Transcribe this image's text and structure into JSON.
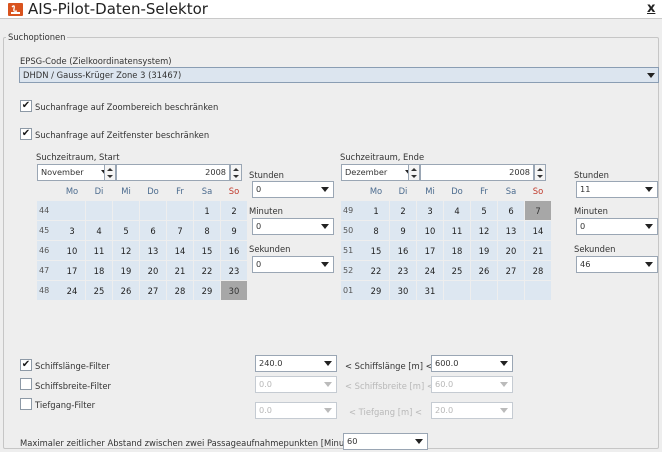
{
  "window": {
    "title": "AIS-Pilot-Daten-Selektor",
    "close_label": "x"
  },
  "options_group": {
    "label": "Suchoptionen"
  },
  "epsg": {
    "label": "EPSG-Code (Zielkoordinatensystem)",
    "value": "DHDN / Gauss-Krüger Zone 3 (31467)"
  },
  "zoom_filter": {
    "label": "Suchanfrage auf Zoombereich beschränken",
    "checked": true
  },
  "time_filter": {
    "label": "Suchanfrage auf Zeitfenster beschränken",
    "checked": true
  },
  "weekday_headers": [
    "Mo",
    "Di",
    "Mi",
    "Do",
    "Fr",
    "Sa",
    "So"
  ],
  "start": {
    "label": "Suchzeitraum, Start",
    "month": "November",
    "year": "2008",
    "weeks": [
      {
        "wk": "44",
        "days": [
          "",
          "",
          "",
          "",
          "",
          "1",
          "2"
        ]
      },
      {
        "wk": "45",
        "days": [
          "3",
          "4",
          "5",
          "6",
          "7",
          "8",
          "9"
        ]
      },
      {
        "wk": "46",
        "days": [
          "10",
          "11",
          "12",
          "13",
          "14",
          "15",
          "16"
        ]
      },
      {
        "wk": "47",
        "days": [
          "17",
          "18",
          "19",
          "20",
          "21",
          "22",
          "23"
        ]
      },
      {
        "wk": "48",
        "days": [
          "24",
          "25",
          "26",
          "27",
          "28",
          "29",
          "30"
        ]
      }
    ],
    "selected_day": "30",
    "hours_label": "Stunden",
    "hours": "0",
    "minutes_label": "Minuten",
    "minutes": "0",
    "seconds_label": "Sekunden",
    "seconds": "0"
  },
  "end": {
    "label": "Suchzeitraum, Ende",
    "month": "Dezember",
    "year": "2008",
    "weeks": [
      {
        "wk": "49",
        "days": [
          "1",
          "2",
          "3",
          "4",
          "5",
          "6",
          "7"
        ]
      },
      {
        "wk": "50",
        "days": [
          "8",
          "9",
          "10",
          "11",
          "12",
          "13",
          "14"
        ]
      },
      {
        "wk": "51",
        "days": [
          "15",
          "16",
          "17",
          "18",
          "19",
          "20",
          "21"
        ]
      },
      {
        "wk": "52",
        "days": [
          "22",
          "23",
          "24",
          "25",
          "26",
          "27",
          "28"
        ]
      },
      {
        "wk": "01",
        "days": [
          "29",
          "30",
          "31",
          "",
          "",
          "",
          ""
        ]
      }
    ],
    "selected_day": "7",
    "hours_label": "Stunden",
    "hours": "11",
    "minutes_label": "Minuten",
    "minutes": "0",
    "seconds_label": "Sekunden",
    "seconds": "46"
  },
  "length_filter": {
    "label": "Schiffslänge-Filter",
    "checked": true,
    "min": "240.0",
    "relation": "< Schiffslänge [m] <",
    "max": "600.0"
  },
  "width_filter": {
    "label": "Schiffsbreite-Filter",
    "checked": false,
    "min": "0.0",
    "relation": "< Schiffsbreite [m] <",
    "max": "60.0"
  },
  "draft_filter": {
    "label": "Tiefgang-Filter",
    "checked": false,
    "min": "0.0",
    "relation": "< Tiefgang [m] <",
    "max": "20.0"
  },
  "max_gap": {
    "label": "Maximaler zeitlicher Abstand zwischen zwei Passageaufnahmepunkten [Minuten]",
    "value": "60"
  },
  "colors": {
    "calendar_cell": "#dde7f1",
    "selected_cell": "#a7a7a7",
    "sunday_header": "#c0392b",
    "combo_bg": "#dce5ef"
  },
  "icons": {
    "app": "java-app-icon",
    "dropdown": "chevron-down-icon",
    "check": "checkmark-icon"
  }
}
